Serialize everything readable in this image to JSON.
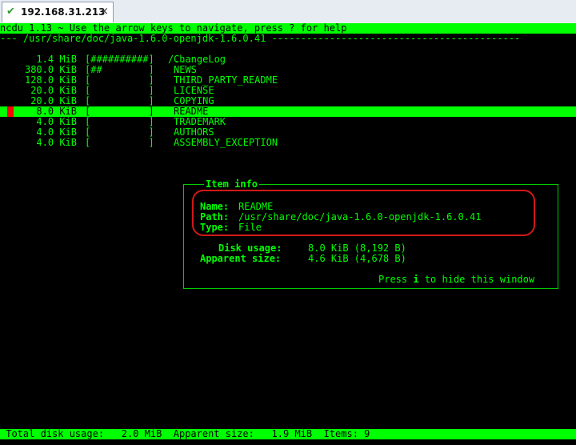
{
  "tab": {
    "title": "192.168.31.213",
    "check_icon": "✔",
    "close_icon": "×"
  },
  "header": {
    "text": "ncdu 1.13 ~ Use the arrow keys to navigate, press ? for help"
  },
  "path_line": "--- /usr/share/doc/java-1.6.0-openjdk-1.6.0.41 -------------------------------------------",
  "parent_dir": "/..",
  "rows": [
    {
      "size": "1.4 MiB",
      "bar": "[##########]",
      "name": "ChangeLog",
      "selected": false
    },
    {
      "size": "380.0 KiB",
      "bar": "[##        ]",
      "name": "NEWS",
      "selected": false
    },
    {
      "size": "128.0 KiB",
      "bar": "[          ]",
      "name": "THIRD_PARTY_README",
      "selected": false
    },
    {
      "size": "20.0 KiB",
      "bar": "[          ]",
      "name": "LICENSE",
      "selected": false
    },
    {
      "size": "20.0 KiB",
      "bar": "[          ]",
      "name": "COPYING",
      "selected": false
    },
    {
      "size": "8.0 KiB",
      "bar": "[          ]",
      "name": "README",
      "selected": true
    },
    {
      "size": "4.0 KiB",
      "bar": "[          ]",
      "name": "TRADEMARK",
      "selected": false
    },
    {
      "size": "4.0 KiB",
      "bar": "[          ]",
      "name": "AUTHORS",
      "selected": false
    },
    {
      "size": "4.0 KiB",
      "bar": "[          ]",
      "name": "ASSEMBLY_EXCEPTION",
      "selected": false
    }
  ],
  "item_info": {
    "title": "Item info",
    "name_label": "Name:",
    "name_value": "README",
    "path_label": "Path:",
    "path_value": "/usr/share/doc/java-1.6.0-openjdk-1.6.0.41",
    "type_label": "Type:",
    "type_value": "File",
    "disk_usage_label": "Disk usage:",
    "disk_usage_value": "8.0 KiB (8,192 B)",
    "apparent_size_label": "Apparent size:",
    "apparent_size_value": "4.6 KiB (4,678 B)",
    "hint_prefix": "Press ",
    "hint_key": "i",
    "hint_suffix": " to hide this window"
  },
  "status_bar": {
    "text": " Total disk usage:   2.0 MiB  Apparent size:   1.9 MiB  Items: 9"
  },
  "colors": {
    "terminal_bg": "#000000",
    "terminal_fg": "#00ff00",
    "annotation": "#d21818"
  }
}
